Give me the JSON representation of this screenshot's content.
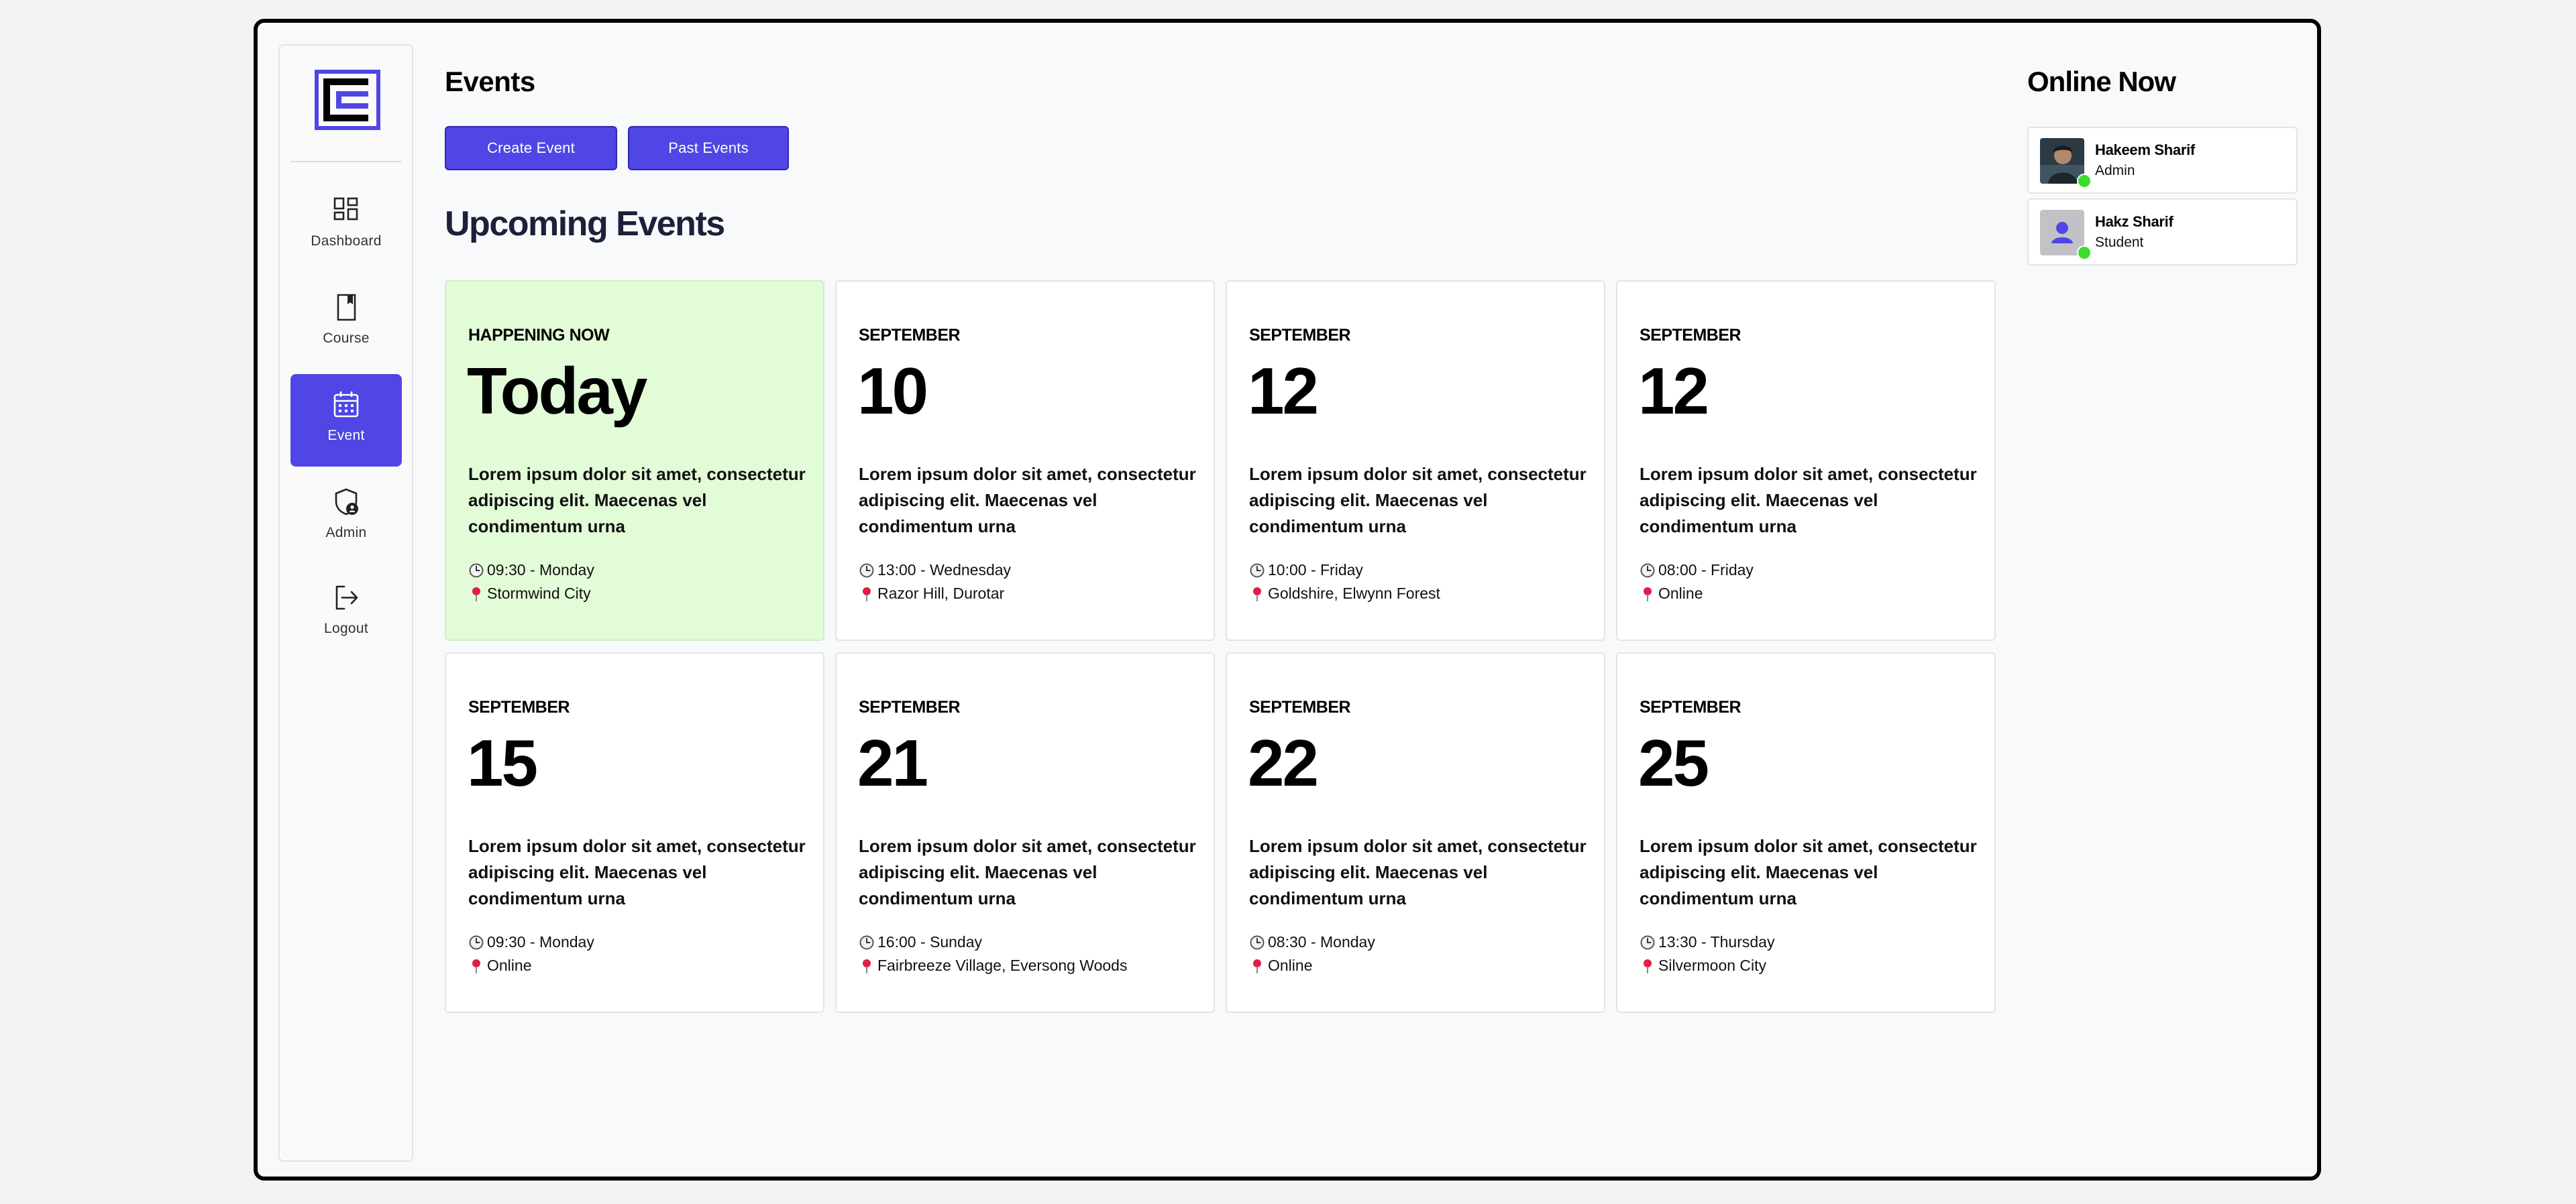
{
  "sidebar": {
    "items": [
      {
        "label": "Dashboard",
        "icon": "dashboard-icon",
        "active": false
      },
      {
        "label": "Course",
        "icon": "book-icon",
        "active": false
      },
      {
        "label": "Event",
        "icon": "calendar-icon",
        "active": true
      },
      {
        "label": "Admin",
        "icon": "shield-user-icon",
        "active": false
      },
      {
        "label": "Logout",
        "icon": "logout-icon",
        "active": false
      }
    ]
  },
  "header": {
    "title": "Events",
    "create_button": "Create Event",
    "past_button": "Past Events"
  },
  "upcoming": {
    "title": "Upcoming Events",
    "events": [
      {
        "month": "HAPPENING NOW",
        "day": "Today",
        "desc": "Lorem ipsum dolor sit amet, consectetur adipiscing elit. Maecenas vel condimentum urna",
        "time": "09:30 - Monday",
        "location": "Stormwind City",
        "highlight": true
      },
      {
        "month": "SEPTEMBER",
        "day": "10",
        "desc": "Lorem ipsum dolor sit amet, consectetur adipiscing elit. Maecenas vel condimentum urna",
        "time": "13:00 - Wednesday",
        "location": "Razor Hill, Durotar",
        "highlight": false
      },
      {
        "month": "SEPTEMBER",
        "day": "12",
        "desc": "Lorem ipsum dolor sit amet, consectetur adipiscing elit. Maecenas vel condimentum urna",
        "time": "10:00 - Friday",
        "location": "Goldshire, Elwynn Forest",
        "highlight": false
      },
      {
        "month": "SEPTEMBER",
        "day": "12",
        "desc": "Lorem ipsum dolor sit amet, consectetur adipiscing elit. Maecenas vel condimentum urna",
        "time": "08:00 - Friday",
        "location": "Online",
        "highlight": false
      },
      {
        "month": "SEPTEMBER",
        "day": "15",
        "desc": "Lorem ipsum dolor sit amet, consectetur adipiscing elit. Maecenas vel condimentum urna",
        "time": "09:30 - Monday",
        "location": "Online",
        "highlight": false
      },
      {
        "month": "SEPTEMBER",
        "day": "21",
        "desc": "Lorem ipsum dolor sit amet, consectetur adipiscing elit. Maecenas vel condimentum urna",
        "time": "16:00 - Sunday",
        "location": "Fairbreeze Village, Eversong Woods",
        "highlight": false
      },
      {
        "month": "SEPTEMBER",
        "day": "22",
        "desc": "Lorem ipsum dolor sit amet, consectetur adipiscing elit. Maecenas vel condimentum urna",
        "time": "08:30 - Monday",
        "location": "Online",
        "highlight": false
      },
      {
        "month": "SEPTEMBER",
        "day": "25",
        "desc": "Lorem ipsum dolor sit amet, consectetur adipiscing elit. Maecenas vel condimentum urna",
        "time": "13:30 - Thursday",
        "location": "Silvermoon City",
        "highlight": false
      }
    ]
  },
  "online": {
    "title": "Online Now",
    "users": [
      {
        "name": "Hakeem Sharif",
        "role": "Admin",
        "avatar": "photo-avatar"
      },
      {
        "name": "Hakz Sharif",
        "role": "Student",
        "avatar": "default-avatar"
      }
    ]
  },
  "colors": {
    "accent": "#4f46e5",
    "highlight_card": "#e3fcd8",
    "online_status": "#3ddc2b",
    "pin": "#e11d48"
  }
}
